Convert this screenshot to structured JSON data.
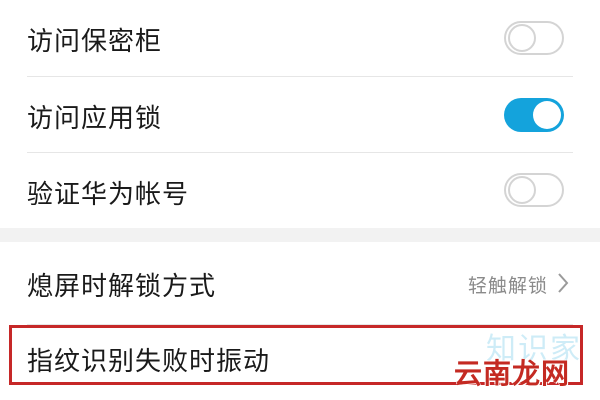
{
  "settings": {
    "items": [
      {
        "label": "访问保密柜",
        "toggle": "off"
      },
      {
        "label": "访问应用锁",
        "toggle": "on"
      },
      {
        "label": "验证华为帐号",
        "toggle": "off"
      }
    ],
    "lock_method": {
      "label": "熄屏时解锁方式",
      "value": "轻触解锁",
      "icon": "chevron-right-icon"
    },
    "vibration": {
      "label": "指纹识别失败时振动",
      "highlighted": true
    }
  },
  "watermark": {
    "faded_text": "知识家",
    "text": "云南龙网"
  },
  "colors": {
    "toggle_on": "#14a3dc",
    "highlight_border": "#c62828",
    "watermark": "#c42a22"
  }
}
